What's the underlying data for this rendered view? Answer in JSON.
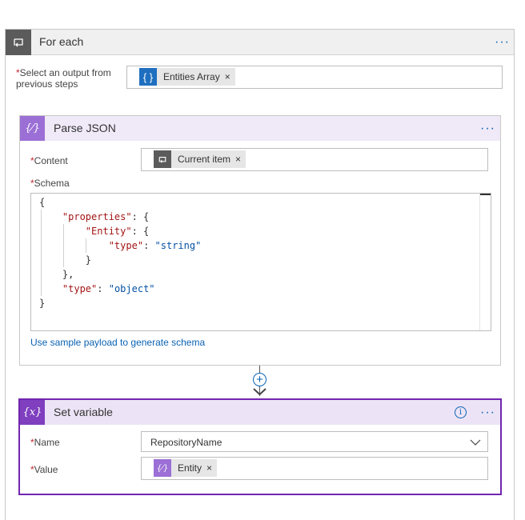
{
  "foreach": {
    "title": "For each",
    "more_label": "···",
    "select_label": "Select an output from previous steps",
    "select_label_line1": "Select an output from",
    "select_label_line2": "previous steps",
    "token_label": "Entities Array",
    "token_icon": "{ }",
    "remove_label": "×"
  },
  "parse_json": {
    "title": "Parse JSON",
    "more_label": "···",
    "icon_text": "{⁄}",
    "content_label": "Content",
    "content_token": "Current item",
    "remove_label": "×",
    "schema_label": "Schema",
    "sample_link": "Use sample payload to generate schema",
    "schema_lines": [
      "{",
      "    \"properties\": {",
      "        \"Entity\": {",
      "            \"type\": \"string\"",
      "        }",
      "    },",
      "    \"type\": \"object\"",
      "}"
    ]
  },
  "connector": {
    "add_label": "+"
  },
  "set_variable": {
    "title": "Set variable",
    "icon_text": "{x}",
    "info_label": "i",
    "more_label": "···",
    "name_label": "Name",
    "name_value": "RepositoryName",
    "value_label": "Value",
    "value_token": "Entity",
    "value_token_icon": "{⁄}",
    "remove_label": "×"
  },
  "colors": {
    "accent_blue": "#0a62b3",
    "foreach_icon_bg": "#5b5b5b",
    "parse_icon_bg": "#9b6fd6",
    "setvar_border": "#7125b0",
    "required": "#c4262e"
  }
}
